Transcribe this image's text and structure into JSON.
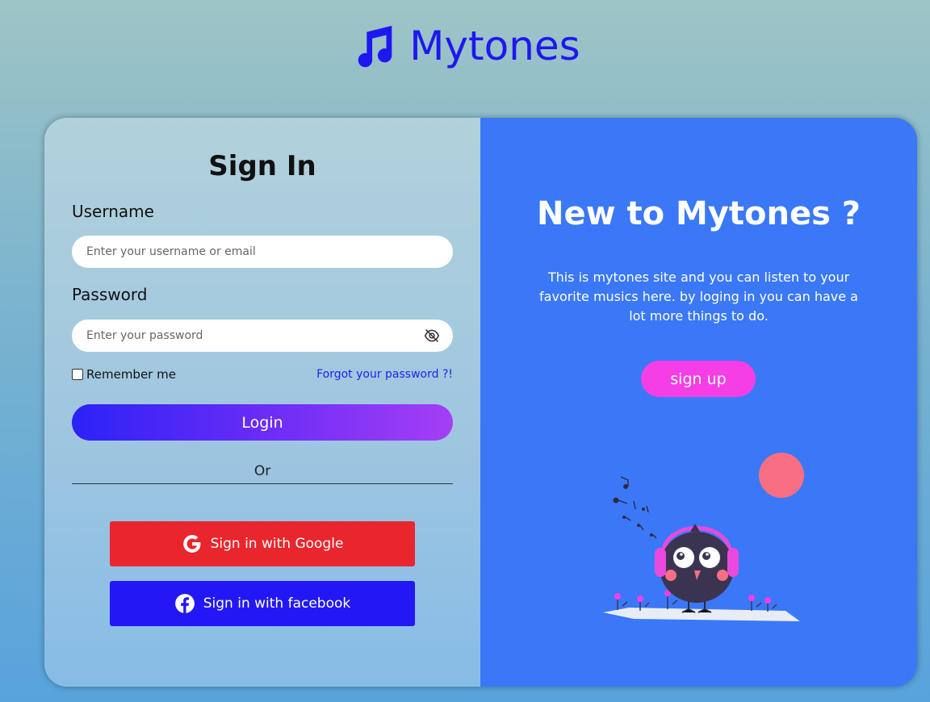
{
  "brand": {
    "name": "Mytones",
    "icon": "music-note-icon",
    "color": "#1e18f0"
  },
  "signin": {
    "title": "Sign In",
    "username_label": "Username",
    "username_placeholder": "Enter your username or email",
    "password_label": "Password",
    "password_placeholder": "Enter your password",
    "password_toggle_icon": "eye-slash-icon",
    "remember_label": "Remember me",
    "forgot_label": "Forgot your password ?!",
    "login_label": "Login",
    "or_label": "Or",
    "google_label": "Sign in with Google",
    "google_icon": "google-icon",
    "facebook_label": "Sign in with facebook",
    "facebook_icon": "facebook-icon"
  },
  "promo": {
    "title": "New to Mytones ?",
    "description": "This is mytones site and you can listen to your favorite musics here. by loging in you can have a lot more things to do.",
    "signup_label": "sign up",
    "illustration": "bird-with-headphones-illustration"
  },
  "colors": {
    "panel_right": "#3a78f8",
    "google": "#e9262d",
    "facebook": "#2318f5",
    "signup": "#f53ee6",
    "link": "#1f1ff0"
  }
}
